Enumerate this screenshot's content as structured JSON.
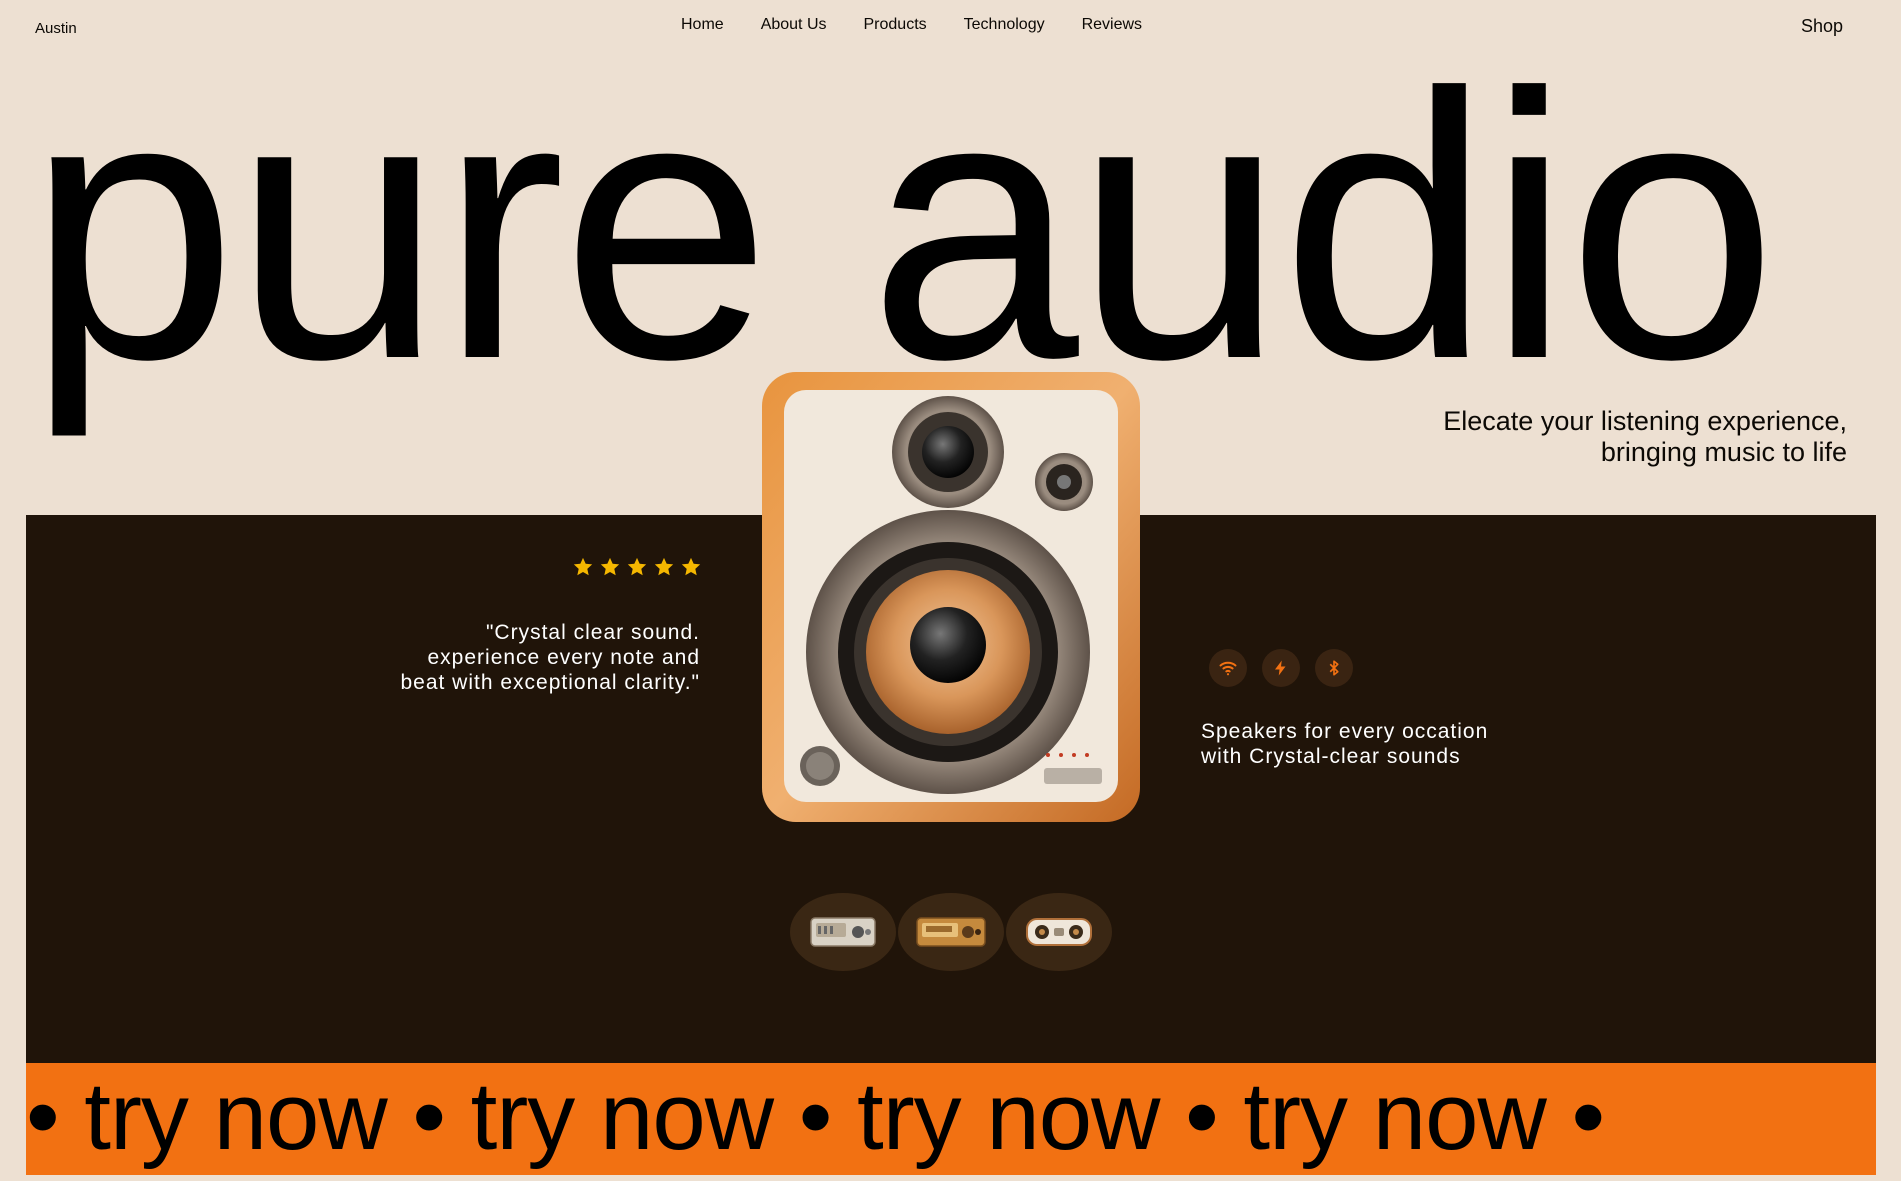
{
  "header": {
    "brand": "Austin",
    "nav": [
      "Home",
      "About Us",
      "Products",
      "Technology",
      "Reviews"
    ],
    "shop_label": "Shop"
  },
  "hero": {
    "headline": "pure audio",
    "tagline_line1": "Elecate your listening experience,",
    "tagline_line2": "bringing music to life"
  },
  "review": {
    "rating": 5,
    "quote_line1": "\"Crystal clear sound.",
    "quote_line2": "experience every note and",
    "quote_line3": "beat with exceptional clarity.\""
  },
  "features": {
    "icons": [
      "wifi-icon",
      "lightning-icon",
      "bluetooth-icon"
    ],
    "text_line1": "Speakers for every occation",
    "text_line2": "with Crystal-clear sounds"
  },
  "thumbnails": [
    "radio-thumbnail-1",
    "radio-thumbnail-2",
    "radio-thumbnail-3"
  ],
  "marquee": {
    "text": "• try now • try now • try now • try now •"
  },
  "colors": {
    "background": "#ede0d2",
    "panel": "#201409",
    "accent": "#f27112",
    "star": "#f5b700"
  }
}
